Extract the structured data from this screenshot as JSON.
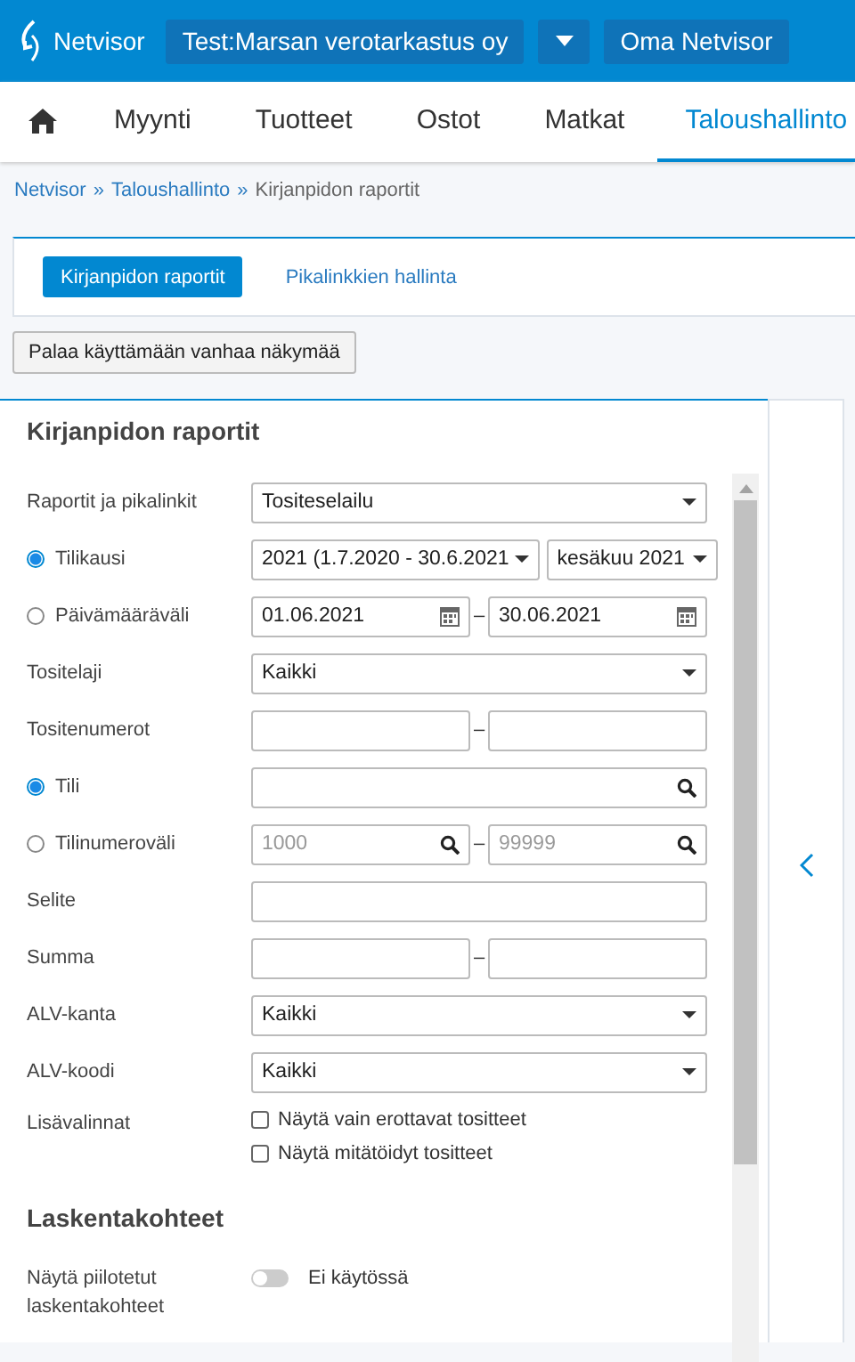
{
  "header": {
    "logo": "Netvisor",
    "company": "Test:Marsan verotarkastus oy",
    "account": "Oma Netvisor"
  },
  "nav": [
    {
      "kind": "home",
      "selected": false
    },
    {
      "label": "Myynti",
      "selected": false
    },
    {
      "label": "Tuotteet",
      "selected": false
    },
    {
      "label": "Ostot",
      "selected": false
    },
    {
      "label": "Matkat",
      "selected": false
    },
    {
      "label": "Taloushallinto",
      "selected": true
    }
  ],
  "breadcrumb": [
    {
      "label": "Netvisor",
      "link": true
    },
    {
      "label": "Taloushallinto",
      "link": true
    },
    {
      "label": "Kirjanpidon raportit",
      "link": false
    }
  ],
  "breadcrumb_separator": "»",
  "subtabs": [
    {
      "label": "Kirjanpidon raportit",
      "selected": true
    },
    {
      "label": "Pikalinkkien hallinta",
      "selected": false
    }
  ],
  "old_view_button": "Palaa käyttämään vanhaa näkymää",
  "panel": {
    "title": "Kirjanpidon raportit",
    "rows": [
      {
        "label": "Raportit ja pikalinkit",
        "fields": [
          {
            "kind": "select",
            "value": "Tositeselailu"
          }
        ]
      },
      {
        "label": "Tilikausi",
        "radio": {
          "selected": true
        },
        "fields": [
          {
            "kind": "select",
            "value": "2021 (1.7.2020 - 30.6.2021"
          },
          {
            "kind": "select",
            "value": "kesäkuu 2021"
          }
        ]
      },
      {
        "label": "Päivämääräväli",
        "radio": {
          "selected": false
        },
        "fields": [
          {
            "kind": "date",
            "value": "01.06.2021"
          },
          {
            "kind": "date",
            "value": "30.06.2021"
          }
        ],
        "separator": "–"
      },
      {
        "label": "Tositelaji",
        "fields": [
          {
            "kind": "select",
            "value": "Kaikki"
          }
        ]
      },
      {
        "label": "Tositenumerot",
        "fields": [
          {
            "kind": "text"
          },
          {
            "kind": "text"
          }
        ],
        "separator": "–"
      },
      {
        "label": "Tili",
        "radio": {
          "selected": true
        },
        "fields": [
          {
            "kind": "search"
          }
        ]
      },
      {
        "label": "Tilinumeroväli",
        "radio": {
          "selected": false
        },
        "fields": [
          {
            "kind": "search",
            "placeholder": "1000"
          },
          {
            "kind": "search",
            "placeholder": "99999"
          }
        ],
        "separator": "–"
      },
      {
        "label": "Selite",
        "fields": [
          {
            "kind": "text"
          }
        ]
      },
      {
        "label": "Summa",
        "fields": [
          {
            "kind": "text"
          },
          {
            "kind": "text"
          }
        ],
        "separator": "–"
      },
      {
        "label": "ALV-kanta",
        "fields": [
          {
            "kind": "select",
            "value": "Kaikki"
          }
        ]
      },
      {
        "label": "ALV-koodi",
        "fields": [
          {
            "kind": "select",
            "value": "Kaikki"
          }
        ]
      },
      {
        "label": "Lisävalinnat",
        "checkboxes": [
          {
            "label": "Näytä vain erottavat tositteet",
            "checked": false
          },
          {
            "label": "Näytä mitätöidyt tositteet",
            "checked": false
          }
        ]
      }
    ],
    "section": {
      "title": "Laskentakohteet",
      "label": "Näytä piilotetut laskentakohteet",
      "toggle": {
        "on": false,
        "label": "Ei käytössä"
      }
    }
  }
}
